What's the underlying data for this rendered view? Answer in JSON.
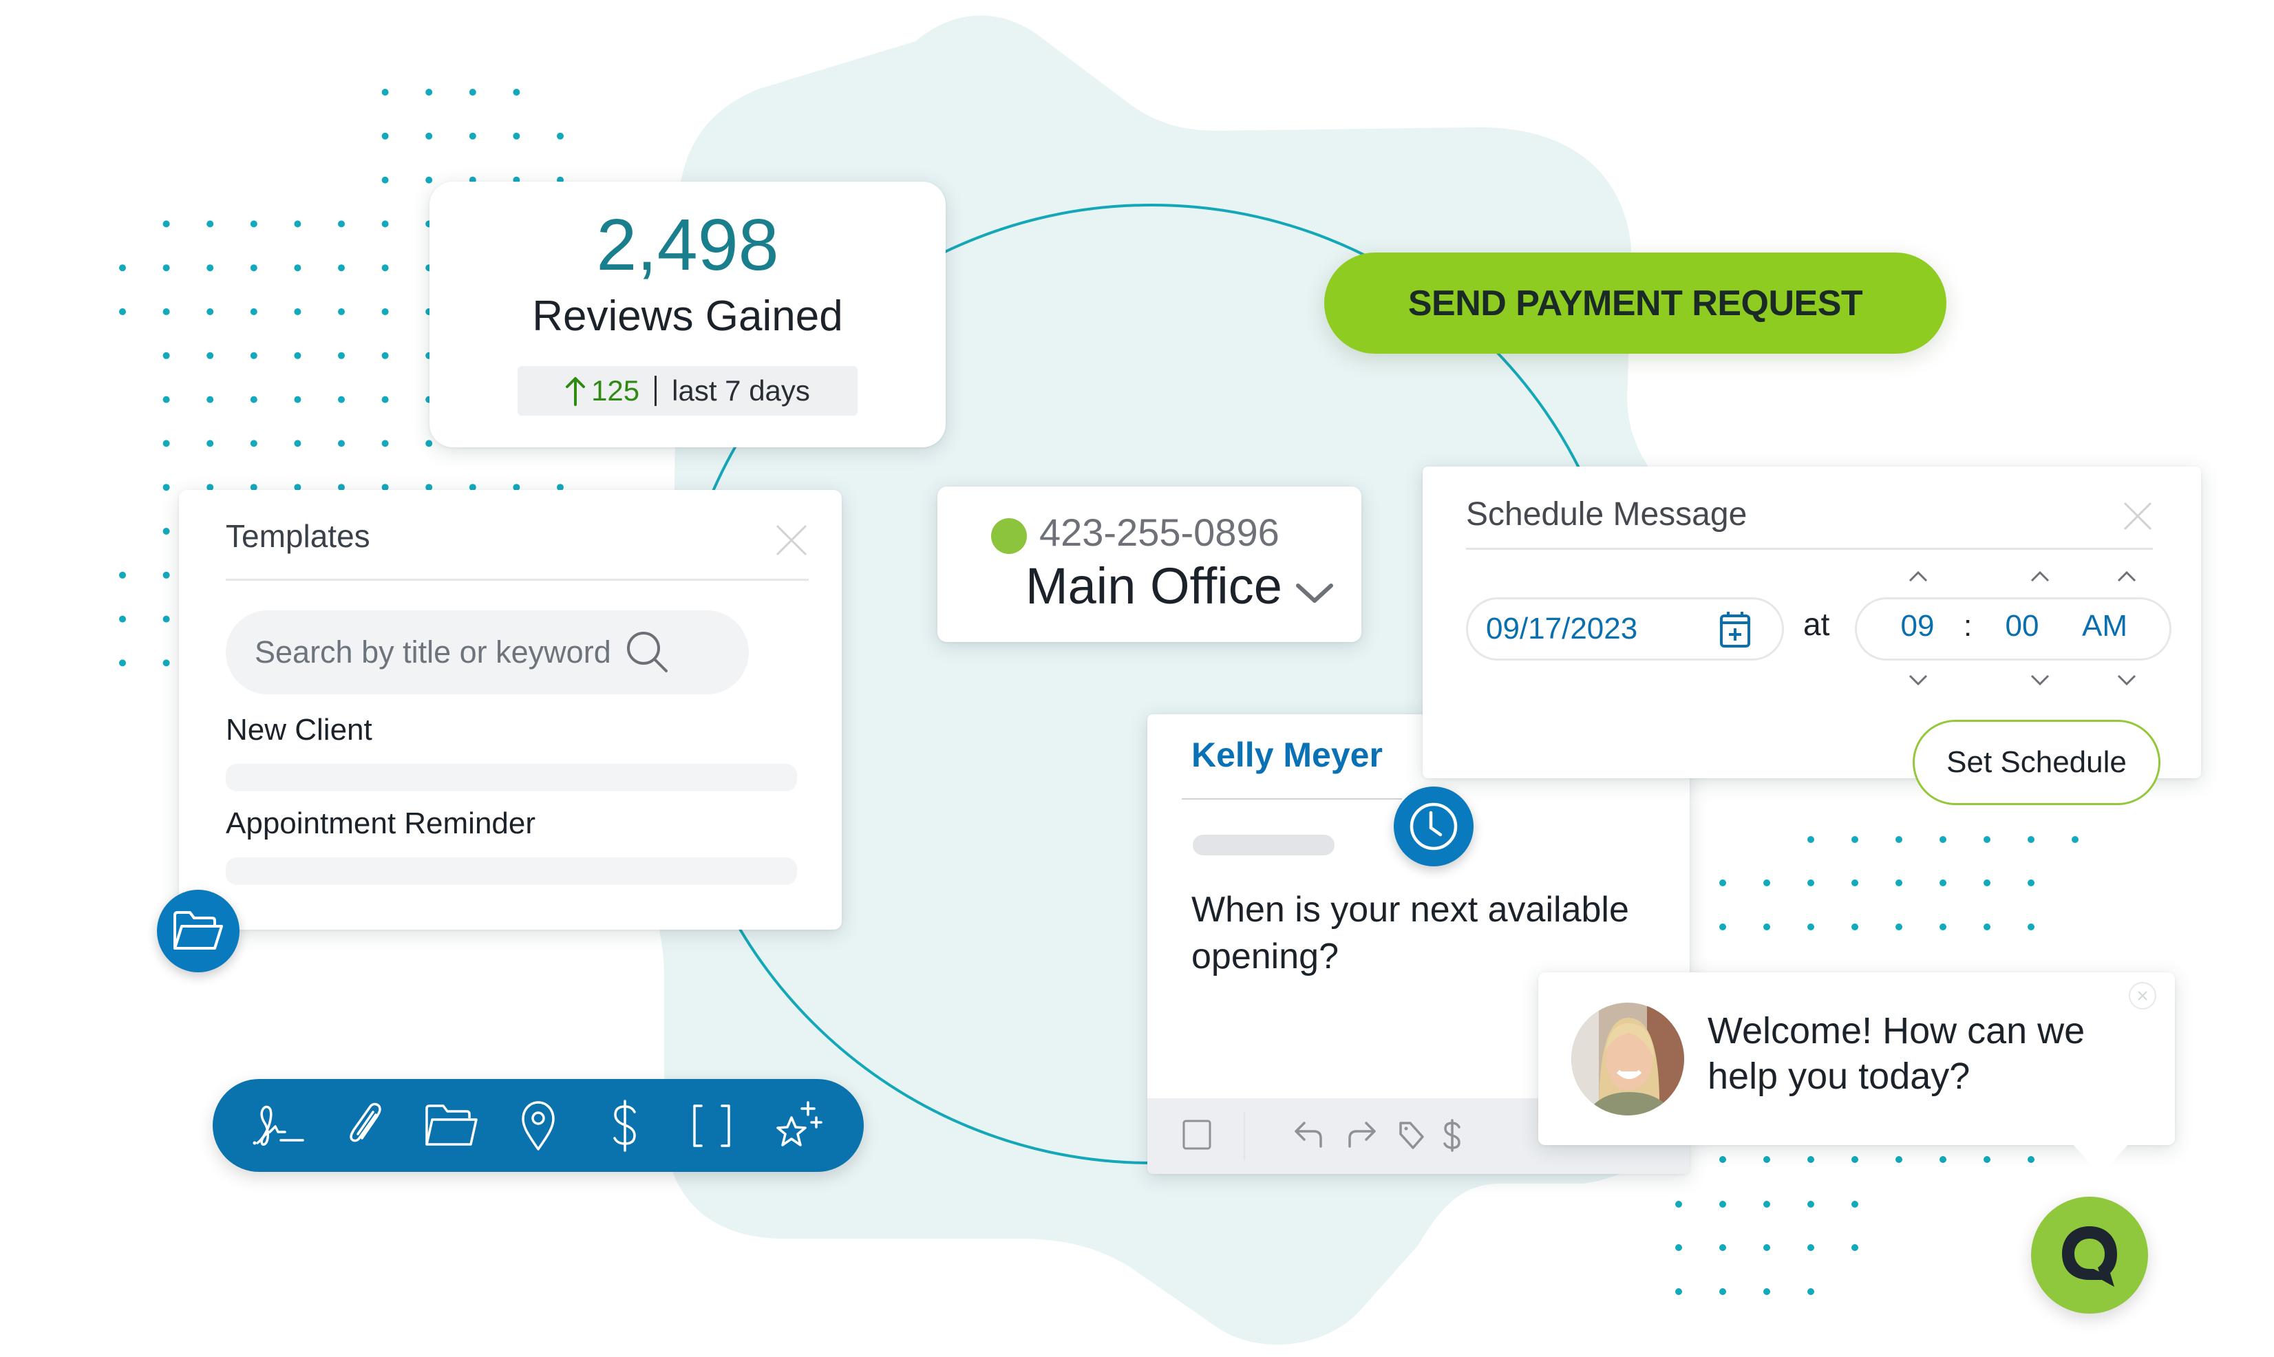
{
  "colors": {
    "teal": "#1a7f8c",
    "brand_blue": "#0a72ac",
    "accent_green": "#8fcc22",
    "status_online": "#8cc43c",
    "trend_up": "#2e8a12",
    "background_blob": "#e8f3f4",
    "dot_grid": "#12a9bd"
  },
  "reviews_card": {
    "count": "2,498",
    "label": "Reviews Gained",
    "change_value": "125",
    "change_direction": "up",
    "period": "last 7 days"
  },
  "payment_button": {
    "label": "SEND PAYMENT REQUEST"
  },
  "templates_panel": {
    "title": "Templates",
    "close_icon": "close-icon",
    "search": {
      "placeholder": "Search by title or keyword",
      "value": ""
    },
    "items": [
      {
        "title": "New Client"
      },
      {
        "title": "Appointment Reminder"
      }
    ]
  },
  "phone_selector": {
    "phone": "423-255-0896",
    "location": "Main Office",
    "status": "online"
  },
  "schedule_panel": {
    "title": "Schedule Message",
    "date": "09/17/2023",
    "at_label": "at",
    "hour": "09",
    "separator": ":",
    "minute": "00",
    "meridiem": "AM",
    "submit_label": "Set Schedule"
  },
  "conversation": {
    "contact_name": "Kelly Meyer",
    "message": "When is your next available opening?",
    "footer_icons": [
      "checkbox-icon",
      "reply-icon",
      "forward-icon",
      "tag-icon",
      "dollar-icon"
    ]
  },
  "chat_widget": {
    "greeting": "Welcome! How can we help you today?",
    "launcher_icon": "q-chat-logo-icon"
  },
  "toolbar": {
    "icons": [
      "signature-icon",
      "paperclip-icon",
      "folder-icon",
      "location-pin-icon",
      "dollar-icon",
      "brackets-icon",
      "sparkle-star-icon"
    ]
  }
}
